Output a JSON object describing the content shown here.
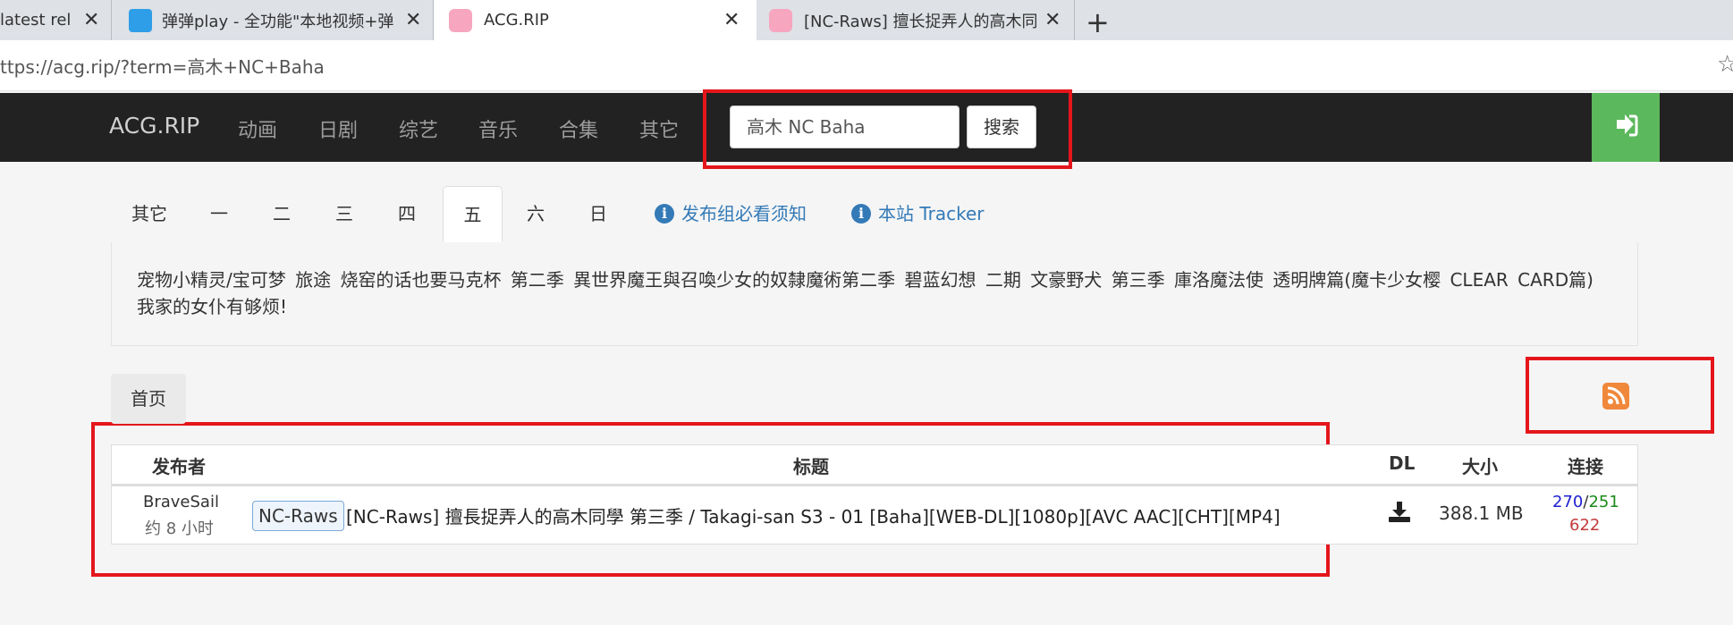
{
  "browser": {
    "tabs": [
      {
        "title": "latest rele",
        "active": false
      },
      {
        "title": "弹弹play - 全功能\"本地视频+弹幕",
        "active": false
      },
      {
        "title": "ACG.RIP",
        "active": true
      },
      {
        "title": "[NC-Raws] 擅长捉弄人的高木同学",
        "active": false
      }
    ],
    "close_glyph": "✕",
    "new_tab_glyph": "+",
    "url": "ttps://acg.rip/?term=高木+NC+Baha",
    "star_glyph": "☆"
  },
  "navbar": {
    "brand": "ACG.RIP",
    "links": [
      "动画",
      "日剧",
      "综艺",
      "音乐",
      "合集",
      "其它"
    ],
    "search_value": "高木 NC Baha",
    "search_button": "搜索",
    "login_icon": "sign-in-icon",
    "login_color": "#5cb85c"
  },
  "days": {
    "tabs": [
      "其它",
      "一",
      "二",
      "三",
      "四",
      "五",
      "六",
      "日"
    ],
    "active_index": 5,
    "info_links": [
      "发布组必看须知",
      "本站 Tracker"
    ],
    "info_icon_glyph": "i"
  },
  "tags_text": "宠物小精灵/宝可梦 旅途   烧窑的话也要马克杯 第二季   異世界魔王與召喚少女的奴隸魔術第二季   碧蓝幻想 二期   文豪野犬 第三季   庫洛魔法使 透明牌篇(魔卡少女樱 CLEAR CARD篇)   我家的女仆有够烦!",
  "breadcrumb": "首页",
  "rss_color": "#f0883b",
  "table": {
    "headers": {
      "publisher": "发布者",
      "title": "标题",
      "dl": "DL",
      "size": "大小",
      "links": "连接"
    },
    "rows": [
      {
        "publisher": "BraveSail",
        "time": "约 8 小时",
        "tag": "NC-Raws",
        "title": "[NC-Raws] 擅長捉弄人的高木同學 第三季 / Takagi-san S3 - 01 [Baha][WEB-DL][1080p][AVC AAC][CHT][MP4]",
        "size": "388.1 MB",
        "seeders": "270",
        "separator": "/",
        "leechers": "251",
        "completed": "622"
      }
    ]
  },
  "highlight_color": "#e4161c"
}
